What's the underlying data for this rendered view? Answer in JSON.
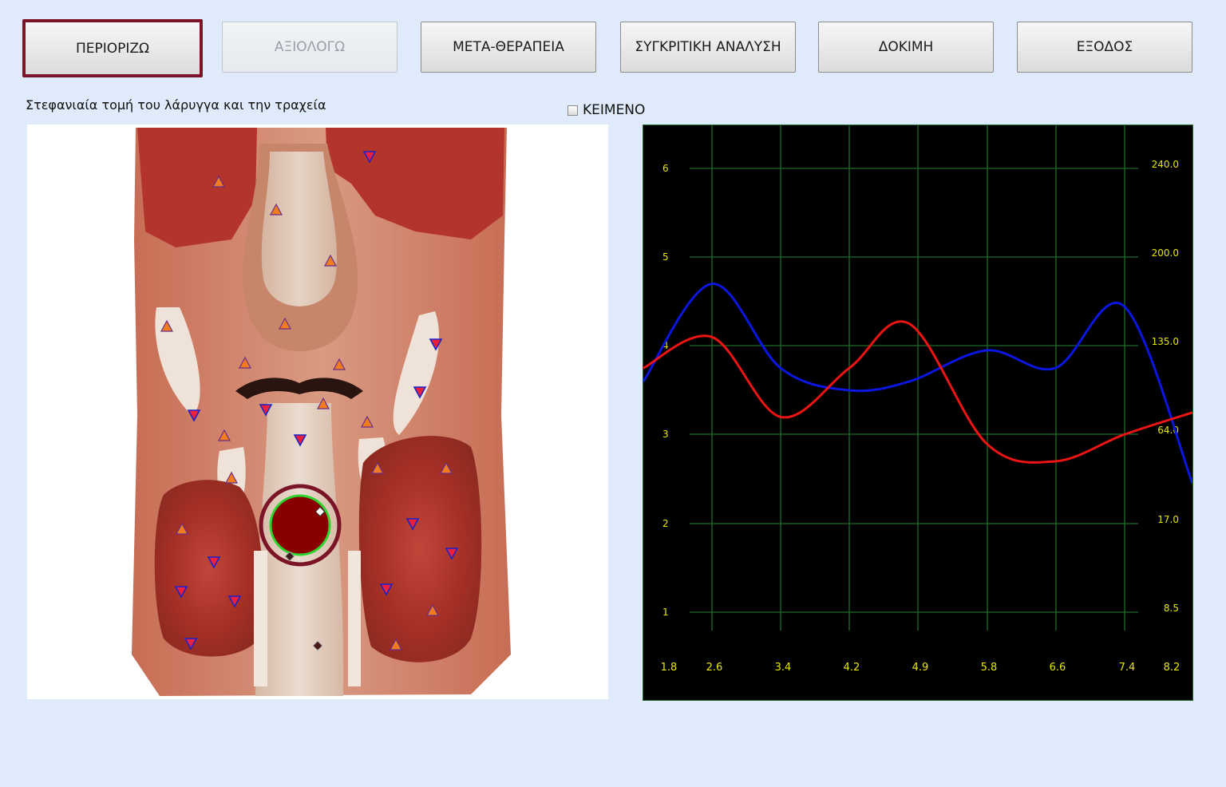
{
  "toolbar": {
    "buttons": [
      {
        "label": "ΠΕΡΙΟΡΙΖΩ",
        "state": "active"
      },
      {
        "label": "ΑΞΙΟΛΟΓΩ",
        "state": "disabled"
      },
      {
        "label": "ΜΕΤΑ-ΘΕΡΑΠΕΙΑ",
        "state": "normal"
      },
      {
        "label": "ΣΥΓΚΡΙΤΙΚΗ ΑΝΑΛΥΣΗ",
        "state": "normal"
      },
      {
        "label": "ΔΟΚΙΜΗ",
        "state": "normal"
      },
      {
        "label": "ΕΞΟΔΟΣ",
        "state": "normal"
      }
    ]
  },
  "image_caption": "Στεφανιαία τομή του λάρυγγα και την τραχεία",
  "text_checkbox": {
    "label": "ΚΕΙΜΕΝΟ",
    "checked": false
  },
  "colors": {
    "accent": "#7a1426",
    "grid": "#1f6b2a",
    "tick": "#e6e600",
    "series_blue": "#0b16e0",
    "series_red": "#ee1414"
  },
  "markers": {
    "up": [
      [
        274,
        228
      ],
      [
        346,
        263
      ],
      [
        414,
        327
      ],
      [
        357,
        406
      ],
      [
        209,
        409
      ],
      [
        307,
        455
      ],
      [
        425,
        457
      ],
      [
        405,
        506
      ],
      [
        460,
        529
      ],
      [
        281,
        546
      ],
      [
        473,
        587
      ],
      [
        290,
        599
      ],
      [
        559,
        587
      ],
      [
        228,
        663
      ],
      [
        542,
        765
      ],
      [
        496,
        808
      ]
    ],
    "down": [
      [
        463,
        196
      ],
      [
        546,
        431
      ],
      [
        526,
        491
      ],
      [
        243,
        520
      ],
      [
        333,
        513
      ],
      [
        376,
        551
      ],
      [
        517,
        656
      ],
      [
        566,
        693
      ],
      [
        268,
        704
      ],
      [
        227,
        741
      ],
      [
        294,
        753
      ],
      [
        484,
        738
      ],
      [
        239,
        806
      ]
    ],
    "diamond": [
      [
        398,
        809
      ]
    ]
  },
  "chart_data": {
    "type": "line",
    "x_ticks": [
      "1.8",
      "2.6",
      "3.4",
      "4.2",
      "4.9",
      "5.8",
      "6.6",
      "7.4",
      "8.2"
    ],
    "y_left_ticks": [
      "6",
      "5",
      "4",
      "3",
      "2",
      "1"
    ],
    "y_right_ticks": [
      "240.0",
      "200.0",
      "135.0",
      "64.0",
      "17.0",
      "8.5"
    ],
    "grid": true,
    "series": [
      {
        "color": "#0b16e0",
        "points": [
          [
            1.8,
            3.6
          ],
          [
            2.6,
            4.7
          ],
          [
            3.4,
            3.75
          ],
          [
            4.2,
            3.5
          ],
          [
            4.9,
            3.6
          ],
          [
            5.8,
            3.95
          ],
          [
            6.6,
            3.75
          ],
          [
            7.4,
            4.45
          ],
          [
            8.2,
            2.45
          ]
        ]
      },
      {
        "color": "#ee1414",
        "points": [
          [
            1.8,
            3.75
          ],
          [
            2.6,
            4.1
          ],
          [
            3.4,
            3.2
          ],
          [
            4.2,
            3.75
          ],
          [
            4.9,
            4.25
          ],
          [
            5.8,
            2.9
          ],
          [
            6.6,
            2.7
          ],
          [
            7.4,
            3.0
          ],
          [
            8.2,
            3.25
          ]
        ]
      }
    ]
  }
}
